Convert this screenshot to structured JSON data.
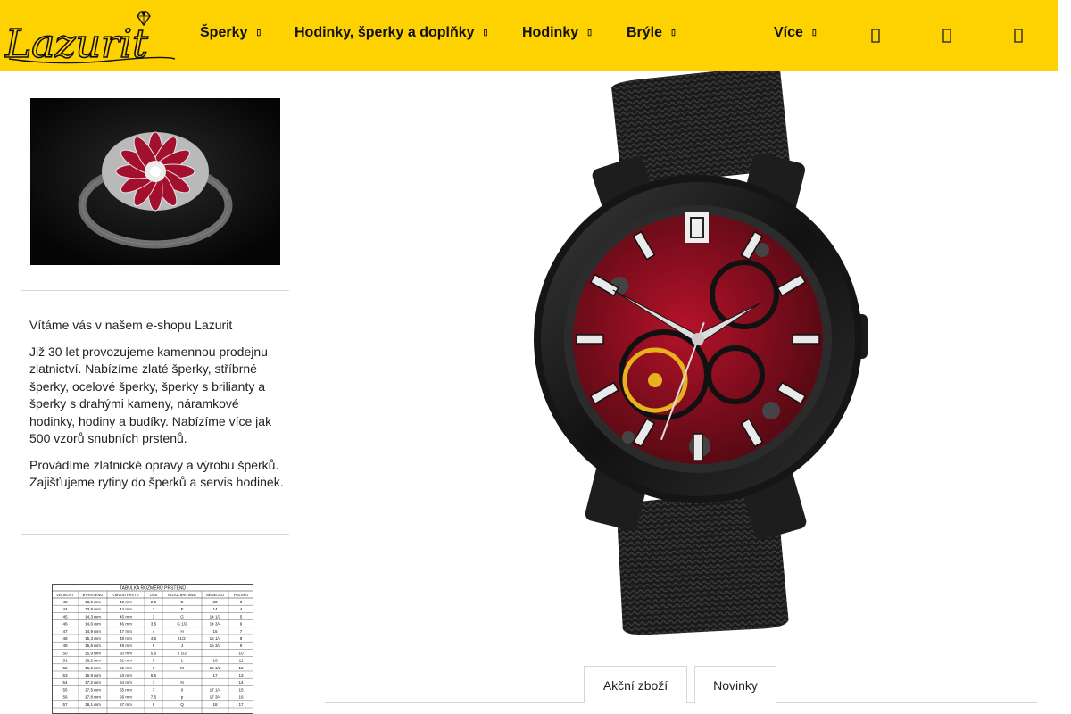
{
  "brand": {
    "logo_text": "Lazurit",
    "accent_color": "#fed100"
  },
  "nav": {
    "items": [
      {
        "label": "Šperky",
        "caret": "▯"
      },
      {
        "label": "Hodinky, šperky a doplňky",
        "caret": "▯"
      },
      {
        "label": "Hodinky",
        "caret": "▯"
      },
      {
        "label": "Brýle",
        "caret": "▯"
      },
      {
        "label": "Více",
        "caret": "▯"
      }
    ],
    "icons": [
      "search-icon",
      "user-icon",
      "cart-icon"
    ],
    "icon_glyph": "▯"
  },
  "sidebar": {
    "welcome_title": "Vítáme vás v našem e-shopu Lazurit",
    "welcome_p1": "Již 30 let provozujeme kamennou prodejnu zlatnictví. Nabízíme zlaté šperky, stříbrné šperky, ocelové šperky, šperky s brilianty a šperky s drahými kameny, náramkové hodinky, hodiny a budíky. Nabízíme více jak 500 vzorů snubních prstenů.",
    "welcome_p2": "Provádíme zlatnické opravy a výrobu šperků. Zajišťujeme rytiny do šperků a servis hodinek.",
    "size_table": {
      "title": "TABULKA ROZMĚRŮ PRSTENŮ",
      "headers": [
        "VELIKOST",
        "ø PRSTENU",
        "OBVOD PRSTU",
        "USA",
        "VELKÁ BRITÁNIE",
        "NĚMECKO",
        "POLSKO"
      ],
      "rows": [
        [
          "43",
          "13,6 mm",
          "43 mm",
          "2,5",
          "E",
          "33",
          "3"
        ],
        [
          "44",
          "13,9 mm",
          "44 mm",
          "3",
          "F",
          "14",
          "4"
        ],
        [
          "45",
          "14,3 mm",
          "45 mm",
          "3",
          "G",
          "14 1/2",
          "5"
        ],
        [
          "46",
          "14,6 mm",
          "46 mm",
          "3,5",
          "G 1/2",
          "14 3/4",
          "6"
        ],
        [
          "47",
          "14,9 mm",
          "47 mm",
          "4",
          "H",
          "15",
          "7"
        ],
        [
          "48",
          "15,3 mm",
          "48 mm",
          "4,5",
          "I1/2",
          "15 1/4",
          "8"
        ],
        [
          "49",
          "15,6 mm",
          "49 mm",
          "5",
          "J",
          "15 3/4",
          "9"
        ],
        [
          "50",
          "15,9 mm",
          "50 mm",
          "5,5",
          "J 1/2",
          "",
          "10"
        ],
        [
          "51",
          "16,2 mm",
          "51 mm",
          "6",
          "L",
          "16",
          "11"
        ],
        [
          "52",
          "16,6 mm",
          "52 mm",
          "6",
          "M",
          "16 1/2",
          "12"
        ],
        [
          "53",
          "16,9 mm",
          "53 mm",
          "6,5",
          "",
          "17",
          "13"
        ],
        [
          "54",
          "17,2 mm",
          "54 mm",
          "7",
          "N",
          "",
          "14"
        ],
        [
          "55",
          "17,5 mm",
          "55 mm",
          "7",
          "0",
          "17 1/4",
          "15"
        ],
        [
          "56",
          "17,8 mm",
          "56 mm",
          "7,5",
          "p",
          "17 3/4",
          "16"
        ],
        [
          "57",
          "18,1 mm",
          "57 mm",
          "8",
          "Q",
          "18",
          "17"
        ]
      ]
    }
  },
  "tabs": [
    {
      "label": "Akční zboží"
    },
    {
      "label": "Novinky"
    }
  ]
}
